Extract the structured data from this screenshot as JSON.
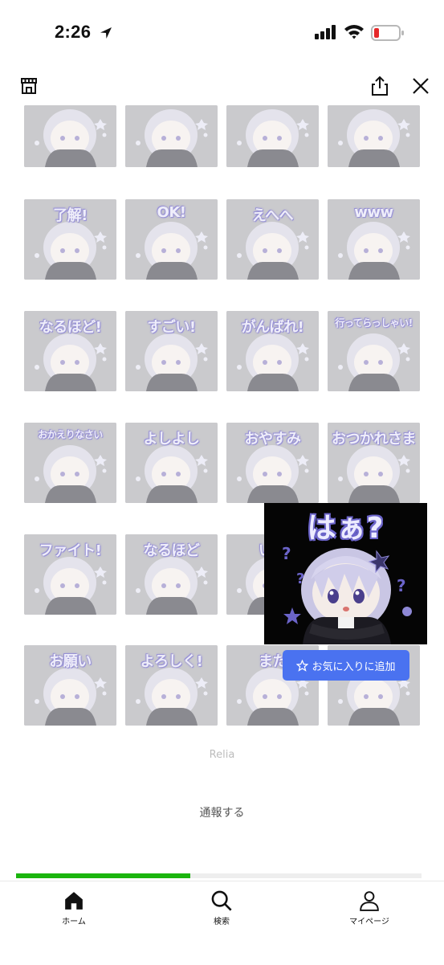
{
  "status_bar": {
    "time": "2:26"
  },
  "header": {
    "store_icon": "store-icon",
    "share_icon": "share-icon",
    "close_icon": "close-icon"
  },
  "stickers": [
    {
      "label": ""
    },
    {
      "label": ""
    },
    {
      "label": ""
    },
    {
      "label": ""
    },
    {
      "label": "了解!"
    },
    {
      "label": "OK!"
    },
    {
      "label": "えへへ"
    },
    {
      "label": "www"
    },
    {
      "label": "なるほど!"
    },
    {
      "label": "すごい!"
    },
    {
      "label": "がんばれ!"
    },
    {
      "label": "行ってらっしゃい!"
    },
    {
      "label": "おかえりなさい"
    },
    {
      "label": "よしよし"
    },
    {
      "label": "おやすみ"
    },
    {
      "label": "おつかれさま"
    },
    {
      "label": "ファイト!"
    },
    {
      "label": "なるほど"
    },
    {
      "label": "いい"
    },
    {
      "label": ""
    },
    {
      "label": "お願い"
    },
    {
      "label": "よろしく!"
    },
    {
      "label": "また"
    },
    {
      "label": ""
    }
  ],
  "preview": {
    "label": "はぁ?",
    "favorite_label": "お気に入りに追加",
    "favorite_icon": "star-outline-icon"
  },
  "author": "Relia",
  "report_label": "通報する",
  "progress": {
    "value_percent": 43
  },
  "tabbar": {
    "tabs": [
      {
        "label": "ホーム",
        "icon": "home-icon",
        "active": true
      },
      {
        "label": "検索",
        "icon": "search-icon",
        "active": false
      },
      {
        "label": "マイページ",
        "icon": "person-icon",
        "active": false
      }
    ]
  }
}
